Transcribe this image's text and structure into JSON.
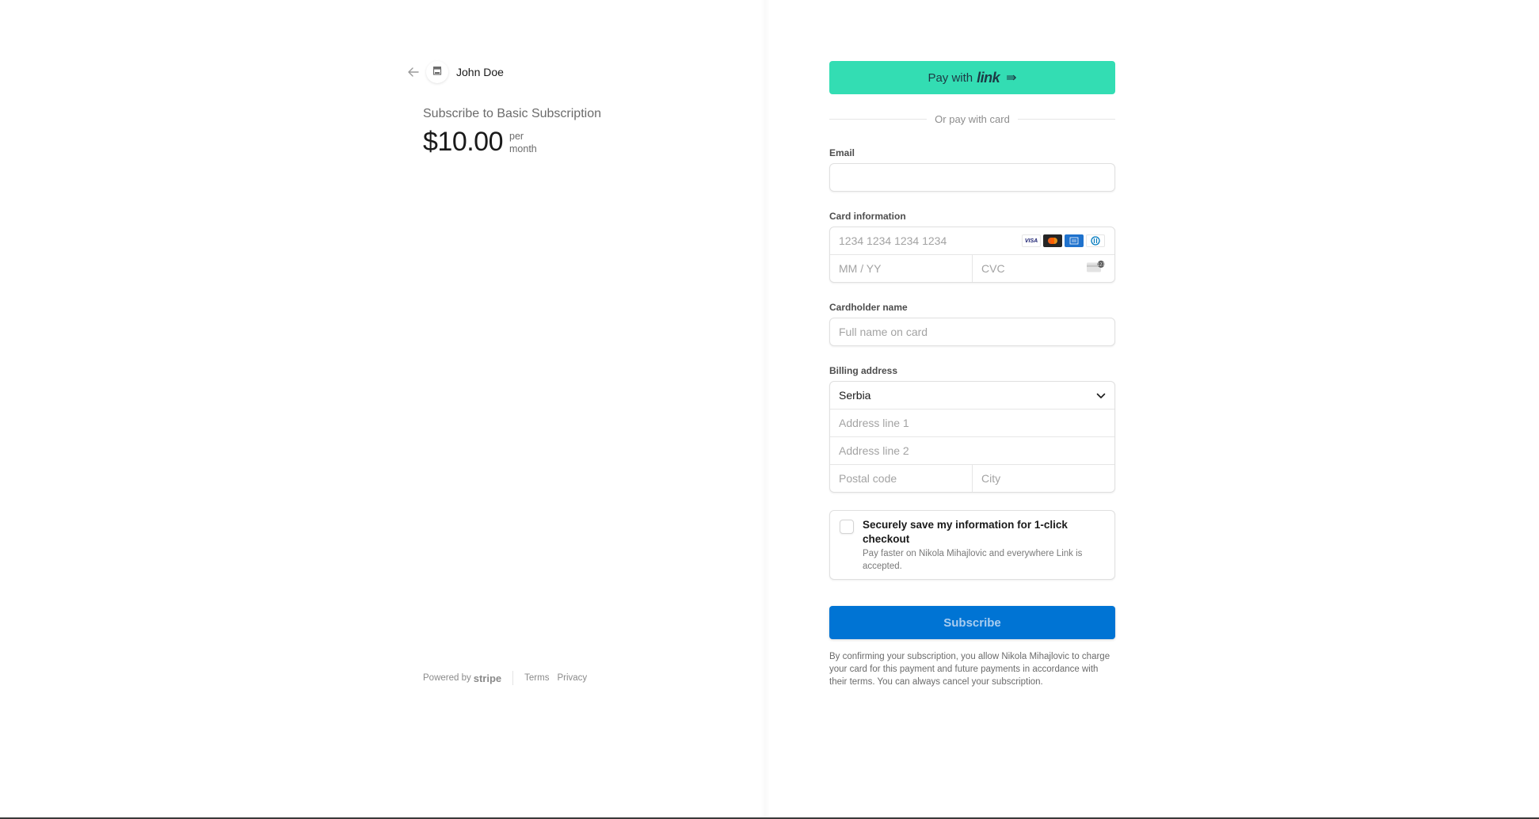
{
  "header": {
    "back_icon": "arrow-left-icon",
    "avatar_icon": "store-icon",
    "merchant_name": "John Doe"
  },
  "product": {
    "title": "Subscribe to Basic Subscription",
    "price": "$10.00",
    "period_line1": "per",
    "period_line2": "month"
  },
  "footer": {
    "powered_by": "Powered by",
    "brand": "stripe",
    "links": [
      "Terms",
      "Privacy"
    ]
  },
  "link_button": {
    "prefix": "Pay with",
    "logo": "link",
    "arrow_icon": "double-arrow-right-icon",
    "color": "#33ddb3"
  },
  "divider_text": "Or pay with card",
  "email": {
    "label": "Email",
    "value": "",
    "placeholder": ""
  },
  "card": {
    "label": "Card information",
    "number_placeholder": "1234 1234 1234 1234",
    "expiry_placeholder": "MM / YY",
    "cvc_placeholder": "CVC",
    "brands": [
      {
        "name": "visa",
        "label": "VISA"
      },
      {
        "name": "mastercard",
        "label": ""
      },
      {
        "name": "amex",
        "label": "AMEX"
      },
      {
        "name": "diners",
        "label": ""
      }
    ]
  },
  "cardholder": {
    "label": "Cardholder name",
    "placeholder": "Full name on card"
  },
  "billing": {
    "label": "Billing address",
    "country": "Serbia",
    "address1_placeholder": "Address line 1",
    "address2_placeholder": "Address line 2",
    "postal_placeholder": "Postal code",
    "city_placeholder": "City"
  },
  "save_info": {
    "title": "Securely save my information for 1-click checkout",
    "description": "Pay faster on Nikola Mihajlovic and everywhere Link is accepted.",
    "checked": false
  },
  "subscribe_button": {
    "label": "Subscribe",
    "color": "#0074d4"
  },
  "legal_text": "By confirming your subscription, you allow Nikola Mihajlovic to charge your card for this payment and future payments in accordance with their terms. You can always cancel your subscription."
}
